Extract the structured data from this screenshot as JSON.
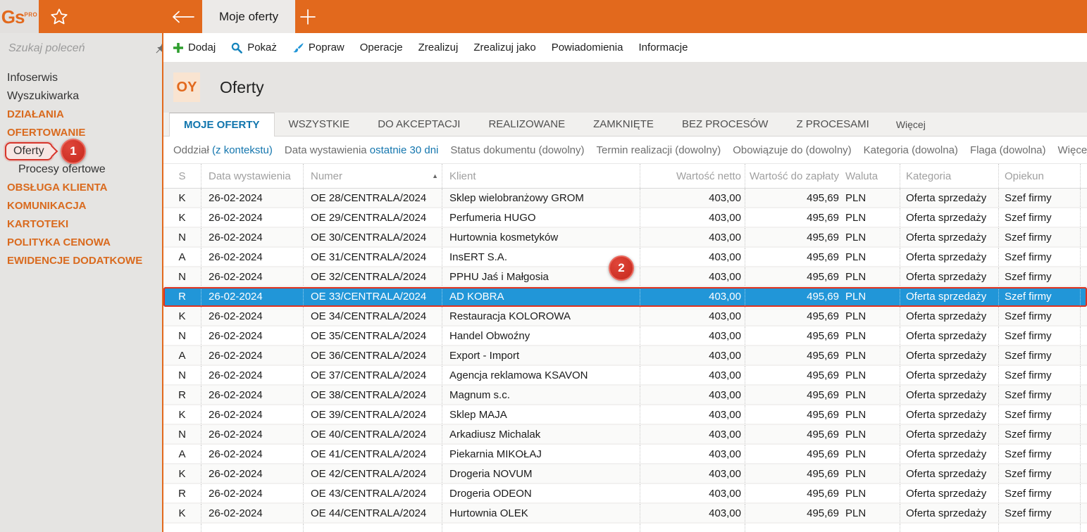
{
  "colors": {
    "accent_orange": "#E2691D",
    "link_blue": "#1476AE",
    "active_tab_blue": "#1075AD",
    "selection_blue": "#2196D8",
    "annotation_red": "#D7342A",
    "sidebar_section_orange": "#D96A1E"
  },
  "topbar": {
    "logo_text": "Gs",
    "logo_sup": "PRO",
    "tab_label": "Moje oferty"
  },
  "sidebar": {
    "search_placeholder": "Szukaj poleceń",
    "items": [
      {
        "label": "Infoserwis",
        "type": "item"
      },
      {
        "label": "Wyszukiwarka",
        "type": "item"
      },
      {
        "label": "DZIAŁANIA",
        "type": "section"
      },
      {
        "label": "OFERTOWANIE",
        "type": "section"
      },
      {
        "label": "Oferty",
        "type": "sub",
        "annotated": true
      },
      {
        "label": "Procesy ofertowe",
        "type": "sub"
      },
      {
        "label": "OBSŁUGA KLIENTA",
        "type": "section"
      },
      {
        "label": "KOMUNIKACJA",
        "type": "section"
      },
      {
        "label": "KARTOTEKI",
        "type": "section"
      },
      {
        "label": "POLITYKA CENOWA",
        "type": "section"
      },
      {
        "label": "EWIDENCJE DODATKOWE",
        "type": "section"
      }
    ]
  },
  "toolbar": {
    "buttons": [
      {
        "label": "Dodaj",
        "icon": "plus"
      },
      {
        "label": "Pokaż",
        "icon": "search"
      },
      {
        "label": "Popraw",
        "icon": "brush"
      },
      {
        "label": "Operacje"
      },
      {
        "label": "Zrealizuj"
      },
      {
        "label": "Zrealizuj jako"
      },
      {
        "label": "Powiadomienia"
      },
      {
        "label": "Informacje"
      }
    ]
  },
  "page": {
    "code": "OY",
    "title": "Oferty"
  },
  "tabs": {
    "items": [
      {
        "label": "MOJE OFERTY",
        "active": true
      },
      {
        "label": "WSZYSTKIE"
      },
      {
        "label": "DO AKCEPTACJI"
      },
      {
        "label": "REALIZOWANE"
      },
      {
        "label": "ZAMKNIĘTE"
      },
      {
        "label": "BEZ PROCESÓW"
      },
      {
        "label": "Z PROCESAMI"
      },
      {
        "label": "Więcej",
        "more": true
      }
    ]
  },
  "filters": {
    "items": [
      {
        "label": "Oddział",
        "value": "(z kontekstu)",
        "link": true
      },
      {
        "label": "Data wystawienia",
        "value": "ostatnie 30 dni",
        "link": true
      },
      {
        "label": "Status dokumentu",
        "value": "(dowolny)",
        "link": false
      },
      {
        "label": "Termin realizacji",
        "value": "(dowolny)",
        "link": false
      },
      {
        "label": "Obowiązuje do",
        "value": "(dowolny)",
        "link": false
      },
      {
        "label": "Kategoria",
        "value": "(dowolna)",
        "link": false
      },
      {
        "label": "Flaga",
        "value": "(dowolna)",
        "link": false
      },
      {
        "label": "Więcej",
        "value": "",
        "link": false
      }
    ]
  },
  "table": {
    "columns": [
      {
        "key": "s",
        "label": "S",
        "align": "center",
        "sep": false
      },
      {
        "key": "date",
        "label": "Data wystawienia",
        "sep": true
      },
      {
        "key": "numer",
        "label": "Numer",
        "sep": true,
        "sorted": "asc"
      },
      {
        "key": "klient",
        "label": "Klient",
        "sep": true
      },
      {
        "key": "netto",
        "label": "Wartość netto",
        "align": "right",
        "sep": true
      },
      {
        "key": "zaplata",
        "label": "Wartość do zapłaty",
        "align": "right",
        "sep": true
      },
      {
        "key": "waluta",
        "label": "Waluta",
        "sep": false
      },
      {
        "key": "kategoria",
        "label": "Kategoria",
        "sep": true
      },
      {
        "key": "opiekun",
        "label": "Opiekun",
        "sep": true
      }
    ],
    "sort_indicator": "▲",
    "rows": [
      {
        "s": "K",
        "date": "26-02-2024",
        "numer": "OE 28/CENTRALA/2024",
        "klient": "Sklep wielobranżowy GROM",
        "netto": "403,00",
        "zaplata": "495,69",
        "waluta": "PLN",
        "kategoria": "Oferta sprzedaży",
        "opiekun": "Szef firmy",
        "selected": false
      },
      {
        "s": "K",
        "date": "26-02-2024",
        "numer": "OE 29/CENTRALA/2024",
        "klient": "Perfumeria HUGO",
        "netto": "403,00",
        "zaplata": "495,69",
        "waluta": "PLN",
        "kategoria": "Oferta sprzedaży",
        "opiekun": "Szef firmy",
        "selected": false
      },
      {
        "s": "N",
        "date": "26-02-2024",
        "numer": "OE 30/CENTRALA/2024",
        "klient": "Hurtownia kosmetyków",
        "netto": "403,00",
        "zaplata": "495,69",
        "waluta": "PLN",
        "kategoria": "Oferta sprzedaży",
        "opiekun": "Szef firmy",
        "selected": false
      },
      {
        "s": "A",
        "date": "26-02-2024",
        "numer": "OE 31/CENTRALA/2024",
        "klient": "InsERT S.A.",
        "netto": "403,00",
        "zaplata": "495,69",
        "waluta": "PLN",
        "kategoria": "Oferta sprzedaży",
        "opiekun": "Szef firmy",
        "selected": false
      },
      {
        "s": "N",
        "date": "26-02-2024",
        "numer": "OE 32/CENTRALA/2024",
        "klient": "PPHU Jaś i Małgosia",
        "netto": "403,00",
        "zaplata": "495,69",
        "waluta": "PLN",
        "kategoria": "Oferta sprzedaży",
        "opiekun": "Szef firmy",
        "selected": false
      },
      {
        "s": "R",
        "date": "26-02-2024",
        "numer": "OE 33/CENTRALA/2024",
        "klient": "AD KOBRA",
        "netto": "403,00",
        "zaplata": "495,69",
        "waluta": "PLN",
        "kategoria": "Oferta sprzedaży",
        "opiekun": "Szef firmy",
        "selected": true
      },
      {
        "s": "K",
        "date": "26-02-2024",
        "numer": "OE 34/CENTRALA/2024",
        "klient": "Restauracja KOLOROWA",
        "netto": "403,00",
        "zaplata": "495,69",
        "waluta": "PLN",
        "kategoria": "Oferta sprzedaży",
        "opiekun": "Szef firmy",
        "selected": false
      },
      {
        "s": "N",
        "date": "26-02-2024",
        "numer": "OE 35/CENTRALA/2024",
        "klient": "Handel Obwoźny",
        "netto": "403,00",
        "zaplata": "495,69",
        "waluta": "PLN",
        "kategoria": "Oferta sprzedaży",
        "opiekun": "Szef firmy",
        "selected": false
      },
      {
        "s": "A",
        "date": "26-02-2024",
        "numer": "OE 36/CENTRALA/2024",
        "klient": "Export - Import",
        "netto": "403,00",
        "zaplata": "495,69",
        "waluta": "PLN",
        "kategoria": "Oferta sprzedaży",
        "opiekun": "Szef firmy",
        "selected": false
      },
      {
        "s": "N",
        "date": "26-02-2024",
        "numer": "OE 37/CENTRALA/2024",
        "klient": "Agencja reklamowa KSAVON",
        "netto": "403,00",
        "zaplata": "495,69",
        "waluta": "PLN",
        "kategoria": "Oferta sprzedaży",
        "opiekun": "Szef firmy",
        "selected": false
      },
      {
        "s": "R",
        "date": "26-02-2024",
        "numer": "OE 38/CENTRALA/2024",
        "klient": "Magnum s.c.",
        "netto": "403,00",
        "zaplata": "495,69",
        "waluta": "PLN",
        "kategoria": "Oferta sprzedaży",
        "opiekun": "Szef firmy",
        "selected": false
      },
      {
        "s": "K",
        "date": "26-02-2024",
        "numer": "OE 39/CENTRALA/2024",
        "klient": "Sklep MAJA",
        "netto": "403,00",
        "zaplata": "495,69",
        "waluta": "PLN",
        "kategoria": "Oferta sprzedaży",
        "opiekun": "Szef firmy",
        "selected": false
      },
      {
        "s": "N",
        "date": "26-02-2024",
        "numer": "OE 40/CENTRALA/2024",
        "klient": "Arkadiusz Michalak",
        "netto": "403,00",
        "zaplata": "495,69",
        "waluta": "PLN",
        "kategoria": "Oferta sprzedaży",
        "opiekun": "Szef firmy",
        "selected": false
      },
      {
        "s": "A",
        "date": "26-02-2024",
        "numer": "OE 41/CENTRALA/2024",
        "klient": "Piekarnia MIKOŁAJ",
        "netto": "403,00",
        "zaplata": "495,69",
        "waluta": "PLN",
        "kategoria": "Oferta sprzedaży",
        "opiekun": "Szef firmy",
        "selected": false
      },
      {
        "s": "K",
        "date": "26-02-2024",
        "numer": "OE 42/CENTRALA/2024",
        "klient": "Drogeria NOVUM",
        "netto": "403,00",
        "zaplata": "495,69",
        "waluta": "PLN",
        "kategoria": "Oferta sprzedaży",
        "opiekun": "Szef firmy",
        "selected": false
      },
      {
        "s": "R",
        "date": "26-02-2024",
        "numer": "OE 43/CENTRALA/2024",
        "klient": "Drogeria ODEON",
        "netto": "403,00",
        "zaplata": "495,69",
        "waluta": "PLN",
        "kategoria": "Oferta sprzedaży",
        "opiekun": "Szef firmy",
        "selected": false
      },
      {
        "s": "K",
        "date": "26-02-2024",
        "numer": "OE 44/CENTRALA/2024",
        "klient": "Hurtownia OLEK",
        "netto": "403,00",
        "zaplata": "495,69",
        "waluta": "PLN",
        "kategoria": "Oferta sprzedaży",
        "opiekun": "Szef firmy",
        "selected": false
      }
    ]
  },
  "annotations": {
    "step1": "1",
    "step2": "2"
  }
}
